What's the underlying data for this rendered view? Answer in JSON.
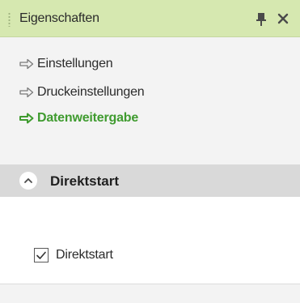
{
  "window": {
    "title": "Eigenschaften",
    "icons": [
      "pin-icon",
      "close-icon"
    ]
  },
  "nav": {
    "items": [
      {
        "label": "Einstellungen",
        "icon": "arrow-right-icon",
        "active": false
      },
      {
        "label": "Druckeinstellungen",
        "icon": "arrow-right-icon",
        "active": false
      },
      {
        "label": "Datenweitergabe",
        "icon": "arrow-right-icon",
        "active": true
      }
    ]
  },
  "section": {
    "title": "Direktstart",
    "expanded": true,
    "icon": "chevron-up-icon",
    "checkbox": {
      "label": "Direktstart",
      "checked": true
    }
  },
  "colors": {
    "title_bar": "#d6e8b0",
    "active_link": "#3f9b2f",
    "section_header": "#d9d9d9"
  }
}
